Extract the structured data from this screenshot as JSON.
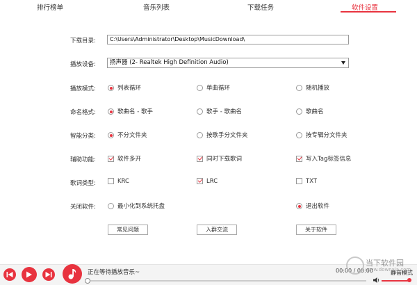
{
  "tabs": [
    {
      "label": "排行榜单",
      "active": false
    },
    {
      "label": "音乐列表",
      "active": false
    },
    {
      "label": "下载任务",
      "active": false
    },
    {
      "label": "软件设置",
      "active": true
    }
  ],
  "settings": {
    "download_dir": {
      "label": "下载目录:",
      "value": "C:\\Users\\Administrator\\Desktop\\MusicDownload\\"
    },
    "playback_device": {
      "label": "播放设备:",
      "value": "扬声器 (2- Realtek High Definition Audio)"
    },
    "play_mode": {
      "label": "播放模式:",
      "options": [
        "列表循环",
        "单曲循环",
        "随机播放"
      ],
      "selected": "列表循环"
    },
    "naming": {
      "label": "命名格式:",
      "options": [
        "歌曲名 - 歌手",
        "歌手 - 歌曲名",
        "歌曲名"
      ],
      "selected": "歌曲名 - 歌手"
    },
    "smart_category": {
      "label": "智能分类:",
      "options": [
        "不分文件夹",
        "按歌手分文件夹",
        "按专辑分文件夹"
      ],
      "selected": "不分文件夹"
    },
    "aux": {
      "label": "辅助功能:",
      "options": [
        "软件多开",
        "同时下载歌词",
        "写入Tag标签信息"
      ],
      "checked": [
        true,
        true,
        true
      ]
    },
    "lyrics_type": {
      "label": "歌词类型:",
      "options": [
        "KRC",
        "LRC",
        "TXT"
      ],
      "checked": [
        false,
        true,
        false
      ]
    },
    "close_software": {
      "label": "关闭软件:",
      "options": [
        "最小化到系统托盘",
        "退出软件"
      ],
      "selected": "退出软件"
    }
  },
  "buttons": {
    "faq": "常见问题",
    "join_group": "入群交流",
    "about": "关于软件"
  },
  "player": {
    "now_playing": "正在等待播放音乐~",
    "time": "00:00 / 00:00",
    "mute_label": "静音模式",
    "progress": 0,
    "volume": 1.0
  },
  "watermark": {
    "line1": "当下软件园",
    "line2": "www.downxia.com"
  },
  "colors": {
    "accent": "#e8333f"
  }
}
